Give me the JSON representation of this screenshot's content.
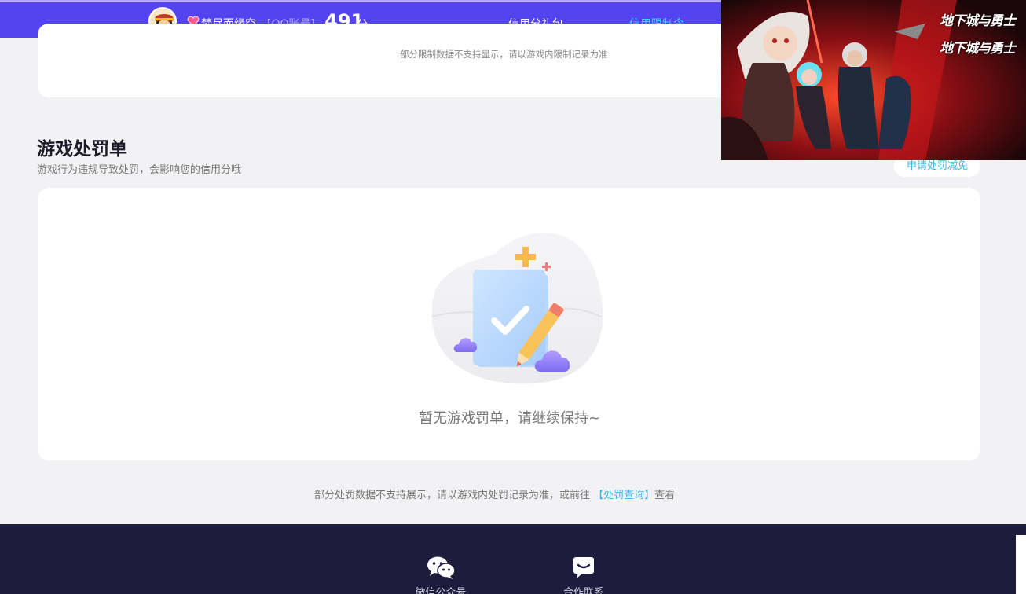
{
  "header": {
    "nickname": "梦尽而缘空",
    "account_type": "[QQ账号]",
    "score": "491",
    "score_unit": "分",
    "nav": [
      {
        "label": "信用分礼包",
        "active": false
      },
      {
        "label": "信用限制令",
        "active": true
      }
    ]
  },
  "limit_card": {
    "note": "部分限制数据不支持显示，请以游戏内限制记录为准"
  },
  "penalty": {
    "title": "游戏处罚单",
    "subtitle": "游戏行为违规导致处罚，会影响您的信用分哦",
    "appeal_button": "申请处罚减免",
    "empty_text": "暂无游戏罚单，请继续保持~",
    "note_prefix": "部分处罚数据不支持展示，请以游戏内处罚记录为准，或前往",
    "note_link": "【处罚查询】",
    "note_suffix": "查看"
  },
  "footer": {
    "items": [
      {
        "label": "微信公众号",
        "icon": "wechat-icon"
      },
      {
        "label": "合作联系",
        "icon": "chat-bubble-icon"
      }
    ]
  },
  "ad": {
    "logo_lines": [
      "地下城与勇士",
      "地下城与勇士"
    ]
  },
  "colors": {
    "header_bg": "#5344f0",
    "accent": "#35e0ef",
    "link": "#3fb6e6",
    "footer_bg": "#1d1c3c"
  }
}
